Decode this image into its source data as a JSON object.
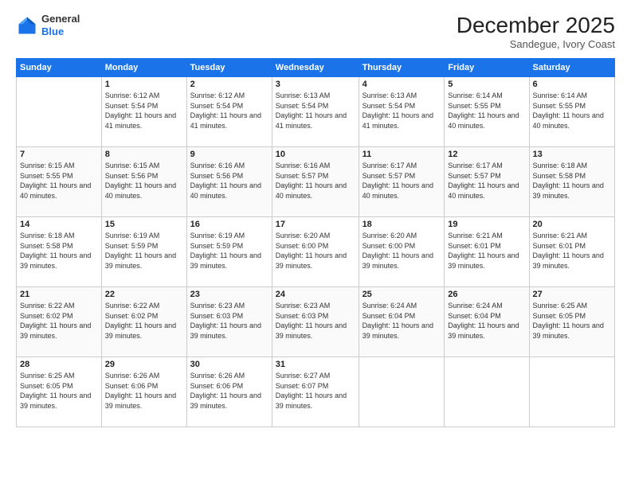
{
  "header": {
    "logo_general": "General",
    "logo_blue": "Blue",
    "month_title": "December 2025",
    "location": "Sandegue, Ivory Coast"
  },
  "days_of_week": [
    "Sunday",
    "Monday",
    "Tuesday",
    "Wednesday",
    "Thursday",
    "Friday",
    "Saturday"
  ],
  "weeks": [
    [
      {
        "day": "",
        "sunrise": "",
        "sunset": "",
        "daylight": ""
      },
      {
        "day": "1",
        "sunrise": "Sunrise: 6:12 AM",
        "sunset": "Sunset: 5:54 PM",
        "daylight": "Daylight: 11 hours and 41 minutes."
      },
      {
        "day": "2",
        "sunrise": "Sunrise: 6:12 AM",
        "sunset": "Sunset: 5:54 PM",
        "daylight": "Daylight: 11 hours and 41 minutes."
      },
      {
        "day": "3",
        "sunrise": "Sunrise: 6:13 AM",
        "sunset": "Sunset: 5:54 PM",
        "daylight": "Daylight: 11 hours and 41 minutes."
      },
      {
        "day": "4",
        "sunrise": "Sunrise: 6:13 AM",
        "sunset": "Sunset: 5:54 PM",
        "daylight": "Daylight: 11 hours and 41 minutes."
      },
      {
        "day": "5",
        "sunrise": "Sunrise: 6:14 AM",
        "sunset": "Sunset: 5:55 PM",
        "daylight": "Daylight: 11 hours and 40 minutes."
      },
      {
        "day": "6",
        "sunrise": "Sunrise: 6:14 AM",
        "sunset": "Sunset: 5:55 PM",
        "daylight": "Daylight: 11 hours and 40 minutes."
      }
    ],
    [
      {
        "day": "7",
        "sunrise": "Sunrise: 6:15 AM",
        "sunset": "Sunset: 5:55 PM",
        "daylight": "Daylight: 11 hours and 40 minutes."
      },
      {
        "day": "8",
        "sunrise": "Sunrise: 6:15 AM",
        "sunset": "Sunset: 5:56 PM",
        "daylight": "Daylight: 11 hours and 40 minutes."
      },
      {
        "day": "9",
        "sunrise": "Sunrise: 6:16 AM",
        "sunset": "Sunset: 5:56 PM",
        "daylight": "Daylight: 11 hours and 40 minutes."
      },
      {
        "day": "10",
        "sunrise": "Sunrise: 6:16 AM",
        "sunset": "Sunset: 5:57 PM",
        "daylight": "Daylight: 11 hours and 40 minutes."
      },
      {
        "day": "11",
        "sunrise": "Sunrise: 6:17 AM",
        "sunset": "Sunset: 5:57 PM",
        "daylight": "Daylight: 11 hours and 40 minutes."
      },
      {
        "day": "12",
        "sunrise": "Sunrise: 6:17 AM",
        "sunset": "Sunset: 5:57 PM",
        "daylight": "Daylight: 11 hours and 40 minutes."
      },
      {
        "day": "13",
        "sunrise": "Sunrise: 6:18 AM",
        "sunset": "Sunset: 5:58 PM",
        "daylight": "Daylight: 11 hours and 39 minutes."
      }
    ],
    [
      {
        "day": "14",
        "sunrise": "Sunrise: 6:18 AM",
        "sunset": "Sunset: 5:58 PM",
        "daylight": "Daylight: 11 hours and 39 minutes."
      },
      {
        "day": "15",
        "sunrise": "Sunrise: 6:19 AM",
        "sunset": "Sunset: 5:59 PM",
        "daylight": "Daylight: 11 hours and 39 minutes."
      },
      {
        "day": "16",
        "sunrise": "Sunrise: 6:19 AM",
        "sunset": "Sunset: 5:59 PM",
        "daylight": "Daylight: 11 hours and 39 minutes."
      },
      {
        "day": "17",
        "sunrise": "Sunrise: 6:20 AM",
        "sunset": "Sunset: 6:00 PM",
        "daylight": "Daylight: 11 hours and 39 minutes."
      },
      {
        "day": "18",
        "sunrise": "Sunrise: 6:20 AM",
        "sunset": "Sunset: 6:00 PM",
        "daylight": "Daylight: 11 hours and 39 minutes."
      },
      {
        "day": "19",
        "sunrise": "Sunrise: 6:21 AM",
        "sunset": "Sunset: 6:01 PM",
        "daylight": "Daylight: 11 hours and 39 minutes."
      },
      {
        "day": "20",
        "sunrise": "Sunrise: 6:21 AM",
        "sunset": "Sunset: 6:01 PM",
        "daylight": "Daylight: 11 hours and 39 minutes."
      }
    ],
    [
      {
        "day": "21",
        "sunrise": "Sunrise: 6:22 AM",
        "sunset": "Sunset: 6:02 PM",
        "daylight": "Daylight: 11 hours and 39 minutes."
      },
      {
        "day": "22",
        "sunrise": "Sunrise: 6:22 AM",
        "sunset": "Sunset: 6:02 PM",
        "daylight": "Daylight: 11 hours and 39 minutes."
      },
      {
        "day": "23",
        "sunrise": "Sunrise: 6:23 AM",
        "sunset": "Sunset: 6:03 PM",
        "daylight": "Daylight: 11 hours and 39 minutes."
      },
      {
        "day": "24",
        "sunrise": "Sunrise: 6:23 AM",
        "sunset": "Sunset: 6:03 PM",
        "daylight": "Daylight: 11 hours and 39 minutes."
      },
      {
        "day": "25",
        "sunrise": "Sunrise: 6:24 AM",
        "sunset": "Sunset: 6:04 PM",
        "daylight": "Daylight: 11 hours and 39 minutes."
      },
      {
        "day": "26",
        "sunrise": "Sunrise: 6:24 AM",
        "sunset": "Sunset: 6:04 PM",
        "daylight": "Daylight: 11 hours and 39 minutes."
      },
      {
        "day": "27",
        "sunrise": "Sunrise: 6:25 AM",
        "sunset": "Sunset: 6:05 PM",
        "daylight": "Daylight: 11 hours and 39 minutes."
      }
    ],
    [
      {
        "day": "28",
        "sunrise": "Sunrise: 6:25 AM",
        "sunset": "Sunset: 6:05 PM",
        "daylight": "Daylight: 11 hours and 39 minutes."
      },
      {
        "day": "29",
        "sunrise": "Sunrise: 6:26 AM",
        "sunset": "Sunset: 6:06 PM",
        "daylight": "Daylight: 11 hours and 39 minutes."
      },
      {
        "day": "30",
        "sunrise": "Sunrise: 6:26 AM",
        "sunset": "Sunset: 6:06 PM",
        "daylight": "Daylight: 11 hours and 39 minutes."
      },
      {
        "day": "31",
        "sunrise": "Sunrise: 6:27 AM",
        "sunset": "Sunset: 6:07 PM",
        "daylight": "Daylight: 11 hours and 39 minutes."
      },
      {
        "day": "",
        "sunrise": "",
        "sunset": "",
        "daylight": ""
      },
      {
        "day": "",
        "sunrise": "",
        "sunset": "",
        "daylight": ""
      },
      {
        "day": "",
        "sunrise": "",
        "sunset": "",
        "daylight": ""
      }
    ]
  ]
}
